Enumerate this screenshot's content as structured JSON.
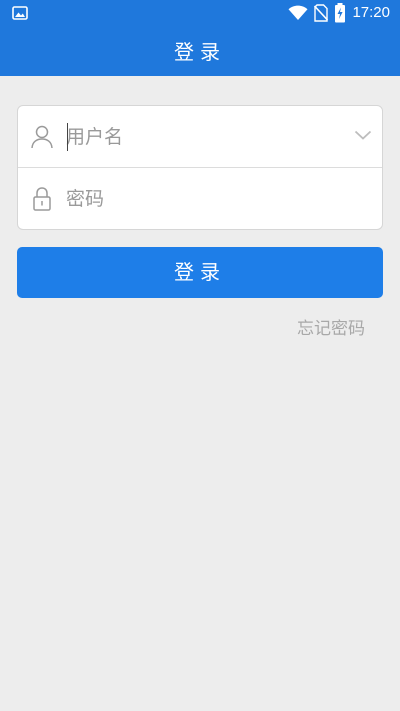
{
  "status_bar": {
    "time": "17:20",
    "icons": [
      "image-icon",
      "wifi-icon",
      "no-sim-icon",
      "battery-charging-icon"
    ]
  },
  "app_bar": {
    "title": "登录"
  },
  "login_form": {
    "username_placeholder": "用户名",
    "username_value": "",
    "password_placeholder": "密码",
    "password_value": "",
    "username_icon": "user-icon",
    "password_icon": "lock-icon",
    "dropdown_icon": "chevron-down-icon"
  },
  "actions": {
    "login_label": "登录",
    "forgot_password_label": "忘记密码"
  },
  "colors": {
    "primary": "#1f78dc",
    "button": "#1e7ee8",
    "background": "#ededed",
    "muted_text": "#a8a8a8"
  }
}
